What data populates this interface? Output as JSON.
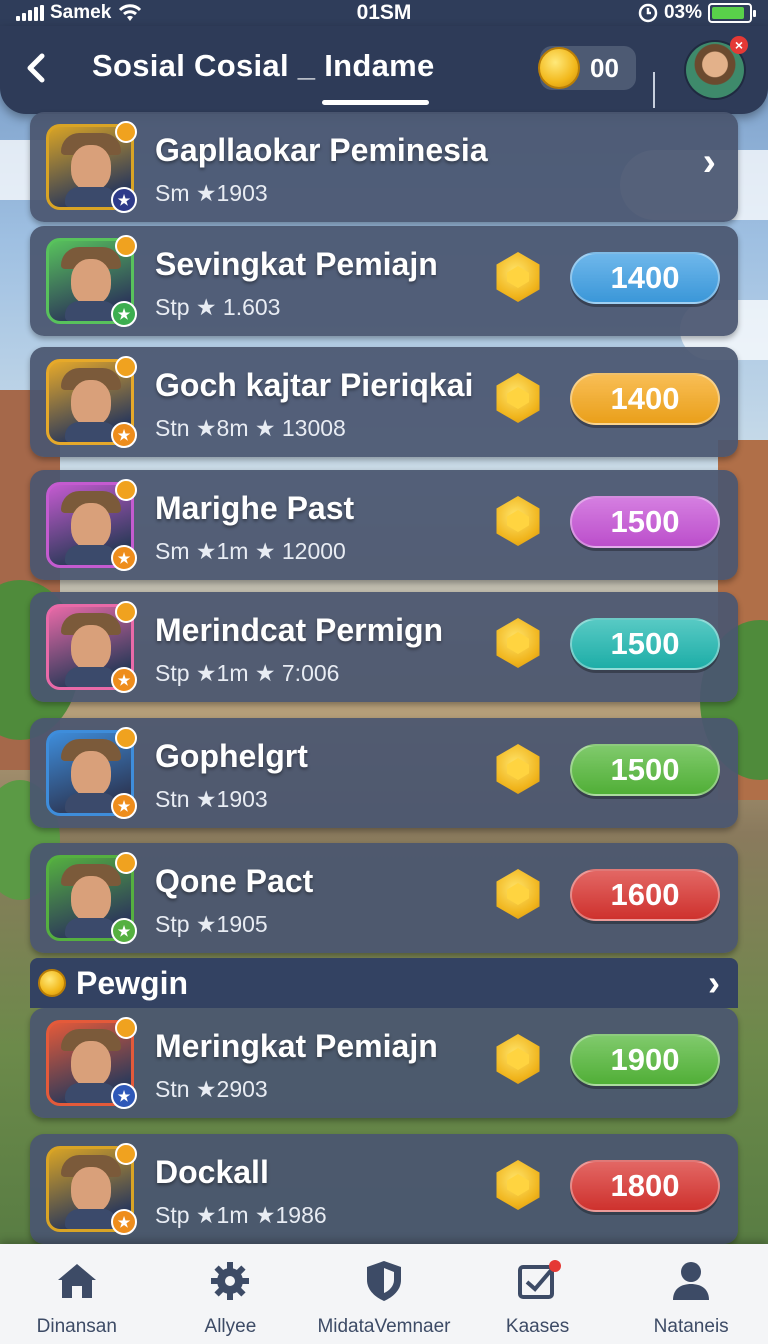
{
  "status_bar": {
    "carrier": "Samek",
    "time": "01SM",
    "battery": "03%",
    "battery_level": 0.9
  },
  "header": {
    "back_icon": "chevron-left-icon",
    "title": "Sosial Cosial _ Indame",
    "coins": "00",
    "coin_icon": "gold-coin-icon"
  },
  "players": [
    {
      "name": "Gapllaokar Peminesia",
      "meta": "Sm ★1903",
      "price": null,
      "avatar_color": "#d9a425",
      "badge_color": "#2e3b8a"
    },
    {
      "name": "Sevingkat Pemiajn",
      "meta": "Stp ★ 1.603",
      "price": "1400",
      "button_color": "#3e9fe4",
      "avatar_color": "#58c25c",
      "badge_color": "#3cae4f"
    },
    {
      "name": "Goch kajtar Pieriqkai",
      "meta": "Stn ★8m ★ 13008",
      "price": "1400",
      "button_color": "#f6a81c",
      "avatar_color": "#e6a92a",
      "badge_color": "#ee8d1c"
    },
    {
      "name": "Marighe Past",
      "meta": "Sm ★1m ★ 12000",
      "price": "1500",
      "button_color": "#c653d6",
      "avatar_color": "#c45bd0",
      "badge_color": "#ee8d1c"
    },
    {
      "name": "Merindcat Permign",
      "meta": "Stp ★1m ★ 7:006",
      "price": "1500",
      "button_color": "#1fb7b0",
      "avatar_color": "#e96aa8",
      "badge_color": "#ee8d1c"
    },
    {
      "name": "Gophelgrt",
      "meta": "Stn ★1903",
      "price": "1500",
      "button_color": "#55b83a",
      "avatar_color": "#3e8ddb",
      "badge_color": "#ee8d1c"
    },
    {
      "name": "Qone Pact",
      "meta": "Stp ★1905",
      "price": "1600",
      "button_color": "#d93430",
      "avatar_color": "#55b040",
      "badge_color": "#55b040"
    }
  ],
  "section": {
    "title": "Pewgin"
  },
  "section_players": [
    {
      "name": "Meringkat Pemiajn",
      "meta": "Stn ★2903",
      "price": "1900",
      "button_color": "#55b83a",
      "avatar_color": "#e45a3a",
      "badge_color": "#2e58b8"
    },
    {
      "name": "Dockall",
      "meta": "Stp ★1m ★1986",
      "price": "1800",
      "button_color": "#d93430",
      "avatar_color": "#d9a425",
      "badge_color": "#ee8d1c"
    }
  ],
  "bottom_nav": [
    {
      "label": "Dinansan",
      "icon": "home-icon"
    },
    {
      "label": "Allyee",
      "icon": "gear-icon"
    },
    {
      "label": "MidataVemnaer",
      "icon": "shield-icon"
    },
    {
      "label": "Kaases",
      "icon": "checkbox-icon"
    },
    {
      "label": "Nataneis",
      "icon": "person-icon"
    }
  ]
}
